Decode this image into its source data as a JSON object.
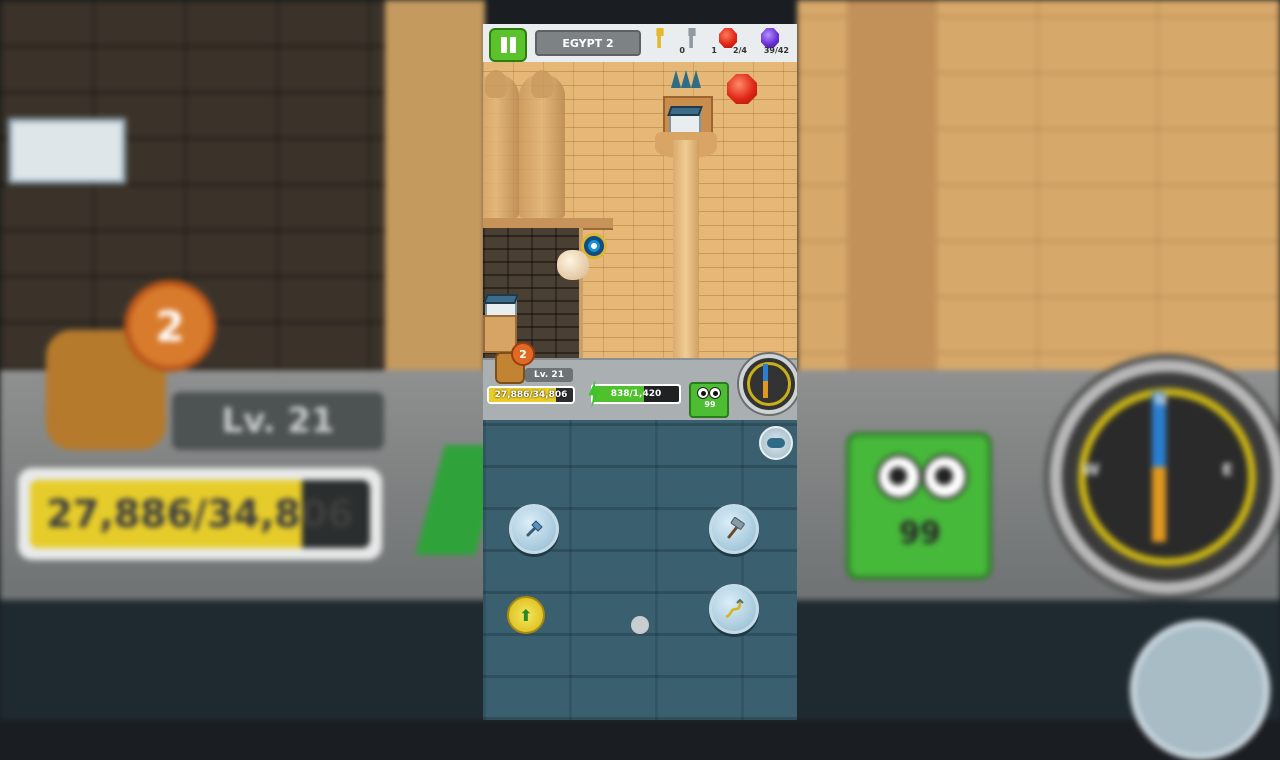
{
  "backdrop": {
    "level_label": "Lv. 21",
    "xp_text": "27,886/34,806",
    "backpack_badge": "2",
    "gem_count": "99",
    "compass_dirs": [
      "N",
      "W",
      "E"
    ]
  },
  "top_bar": {
    "level_name": "EGYPT 2",
    "gold_keys": "0",
    "silver_keys": "1",
    "red_gems": "2/4",
    "purple_gems": "39/42"
  },
  "hud": {
    "backpack_badge": "2",
    "level_label": "Lv. 21",
    "xp_text": "27,886/34,806",
    "xp_fraction": 0.801,
    "energy_text": "838/1,420",
    "energy_fraction": 0.59,
    "gem_count": "99"
  },
  "tools": {
    "shovel_icon": "shovel-icon",
    "hammer_icon": "hammer-icon",
    "grapple_icon": "grapple-hook-icon",
    "up_icon": "up-arrow-icon",
    "gamepad_icon": "gamepad-icon"
  },
  "colors": {
    "pause_green": "#5cc22c",
    "energy_green": "#4ec12c",
    "xp_yellow": "#e9cc28",
    "compass_needle_north": "#2b7fd0"
  }
}
